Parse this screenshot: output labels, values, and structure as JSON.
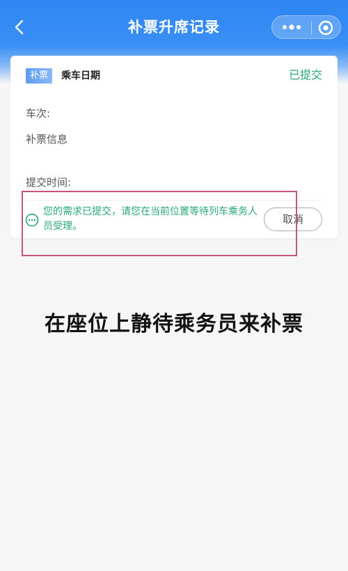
{
  "header": {
    "title": "补票升席记录"
  },
  "card": {
    "tag": "补票",
    "date_label": "乘车日期",
    "status": "已提交",
    "train_label": "车次:",
    "ticket_label": "补票信息",
    "time_label": "提交时间:",
    "notice": "您的需求已提交，请您在当前位置等待列车乘务人员受理。",
    "cancel_label": "取消"
  },
  "caption": "在座位上静待乘务员来补票",
  "colors": {
    "header_blue": "#2f86f2",
    "status_green": "#2aa876",
    "highlight": "#c6557c"
  }
}
